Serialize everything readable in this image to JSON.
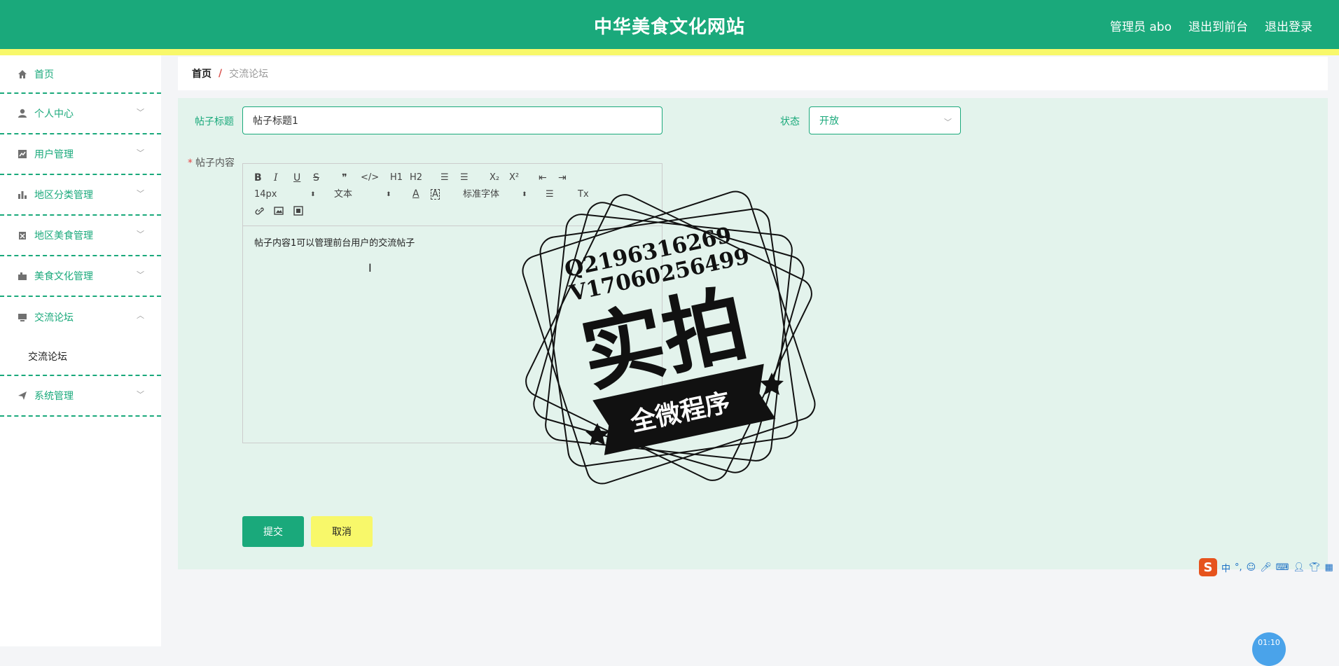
{
  "header": {
    "title": "中华美食文化网站",
    "admin_label": "管理员 abo",
    "front_link": "退出到前台",
    "logout_link": "退出登录"
  },
  "sidebar": {
    "items": [
      {
        "label": "首页",
        "icon": "home-icon"
      },
      {
        "label": "个人中心",
        "icon": "user-icon"
      },
      {
        "label": "用户管理",
        "icon": "chart-icon"
      },
      {
        "label": "地区分类管理",
        "icon": "bar-chart-icon"
      },
      {
        "label": "地区美食管理",
        "icon": "clipboard-icon"
      },
      {
        "label": "美食文化管理",
        "icon": "briefcase-icon"
      },
      {
        "label": "交流论坛",
        "icon": "monitor-icon"
      },
      {
        "label": "系统管理",
        "icon": "send-icon"
      }
    ],
    "subitem": "交流论坛"
  },
  "breadcrumb": {
    "home": "首页",
    "separator": "/",
    "current": "交流论坛"
  },
  "form": {
    "title_label": "帖子标题",
    "title_value": "帖子标题1",
    "status_label": "状态",
    "status_value": "开放",
    "content_label": "帖子内容",
    "content_value": "帖子内容1可以管理前台用户的交流帖子"
  },
  "toolbar": {
    "bold": "B",
    "italic": "I",
    "underline": "U",
    "strike": "S",
    "quote": "❞",
    "code": "</>",
    "h1": "H1",
    "h2": "H2",
    "ordered_list": "☰",
    "bullet_list": "☰",
    "sub": "X₂",
    "sup": "X²",
    "outdent": "⇤",
    "indent": "⇥",
    "size": "14px",
    "header": "文本",
    "font": "标准字体",
    "color": "A",
    "background": "A",
    "align": "☰",
    "clean": "Tx"
  },
  "buttons": {
    "submit": "提交",
    "cancel": "取消"
  },
  "watermark": {
    "line1": "Q2196316269",
    "line2": "V17060256499",
    "main": "实拍",
    "banner": "全微程序"
  },
  "ime": {
    "logo": "S",
    "lang": "中",
    "punct": "°,",
    "time": "01:10"
  }
}
